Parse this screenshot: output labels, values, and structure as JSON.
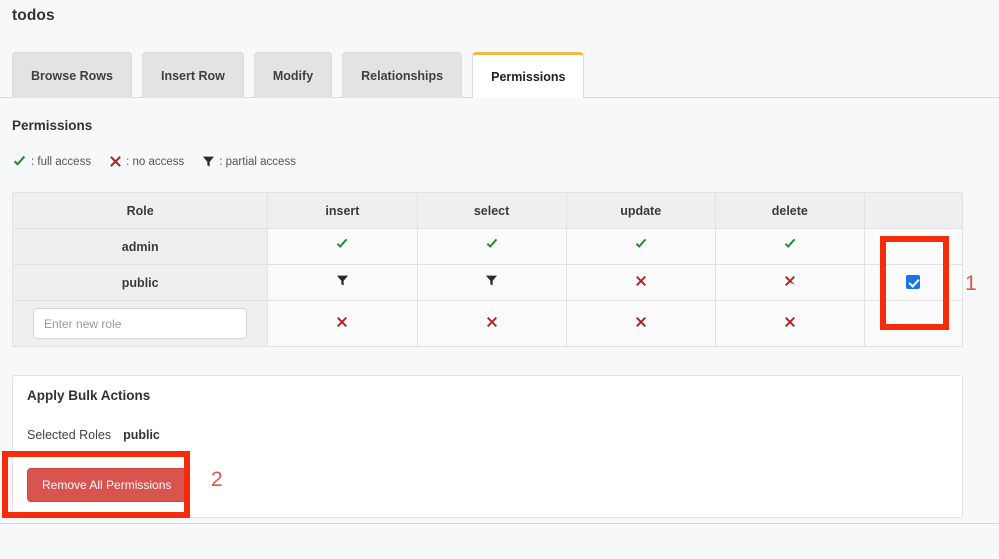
{
  "page": {
    "title": "todos"
  },
  "tabs": [
    {
      "label": "Browse Rows",
      "active": false
    },
    {
      "label": "Insert Row",
      "active": false
    },
    {
      "label": "Modify",
      "active": false
    },
    {
      "label": "Relationships",
      "active": false
    },
    {
      "label": "Permissions",
      "active": true
    }
  ],
  "permissions": {
    "section_title": "Permissions",
    "legend": [
      {
        "icon": "check-icon",
        "label": ": full access",
        "color": "#1d8a2b"
      },
      {
        "icon": "cross-icon",
        "label": ": no access",
        "color": "#b22222"
      },
      {
        "icon": "funnel-icon",
        "label": ": partial access",
        "color": "#2b2b2b"
      }
    ],
    "columns": [
      "Role",
      "insert",
      "select",
      "update",
      "delete",
      ""
    ],
    "rows": [
      {
        "role": "admin",
        "insert": "full",
        "select": "full",
        "update": "full",
        "delete": "full",
        "selected": false
      },
      {
        "role": "public",
        "insert": "partial",
        "select": "partial",
        "update": "none",
        "delete": "none",
        "selected": true
      }
    ],
    "new_role": {
      "placeholder": "Enter new role",
      "value": "",
      "insert": "none",
      "select": "none",
      "update": "none",
      "delete": "none"
    }
  },
  "bulk_actions": {
    "title": "Apply Bulk Actions",
    "selected_roles_label": "Selected Roles",
    "selected_roles_value": "public",
    "remove_button_label": "Remove All Permissions"
  },
  "annotations": [
    {
      "number": "1",
      "target": "public-row-select-checkbox"
    },
    {
      "number": "2",
      "target": "remove-all-permissions-button"
    }
  ],
  "colors": {
    "accent_tab": "#f4b942",
    "danger": "#d9534f",
    "annotation": "#f42c0a",
    "annotation_number": "#e0574f",
    "checkbox": "#1a73e8",
    "full_access": "#1d8a2b",
    "no_access": "#b22222"
  }
}
